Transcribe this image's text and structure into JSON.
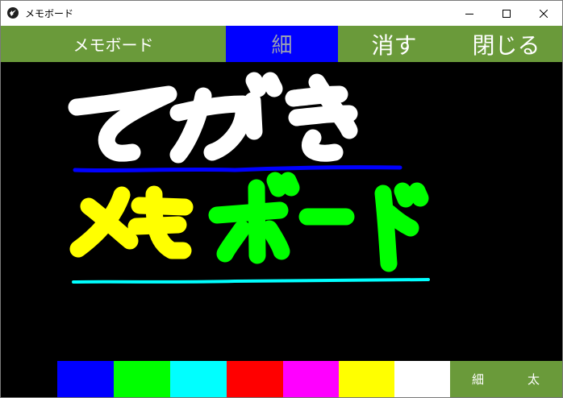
{
  "window": {
    "title": "メモボード"
  },
  "toolbar": {
    "label": "メモボード",
    "thin_button": "細",
    "erase_button": "消す",
    "close_button": "閉じる"
  },
  "canvas": {
    "background": "#000000",
    "drawing_lines": [
      "てがき",
      "メモボード"
    ],
    "stroke_colors": [
      "#ffffff",
      "#0000ff",
      "#ffff00",
      "#00ff00",
      "#00ffff"
    ]
  },
  "palette": {
    "colors": [
      "#0000ff",
      "#00ff00",
      "#00ffff",
      "#ff0000",
      "#ff00ff",
      "#ffff00",
      "#ffffff"
    ],
    "thin_label": "細",
    "thick_label": "太"
  },
  "theme": {
    "accent": "#6a9a3a",
    "selected": "#0000ff"
  }
}
